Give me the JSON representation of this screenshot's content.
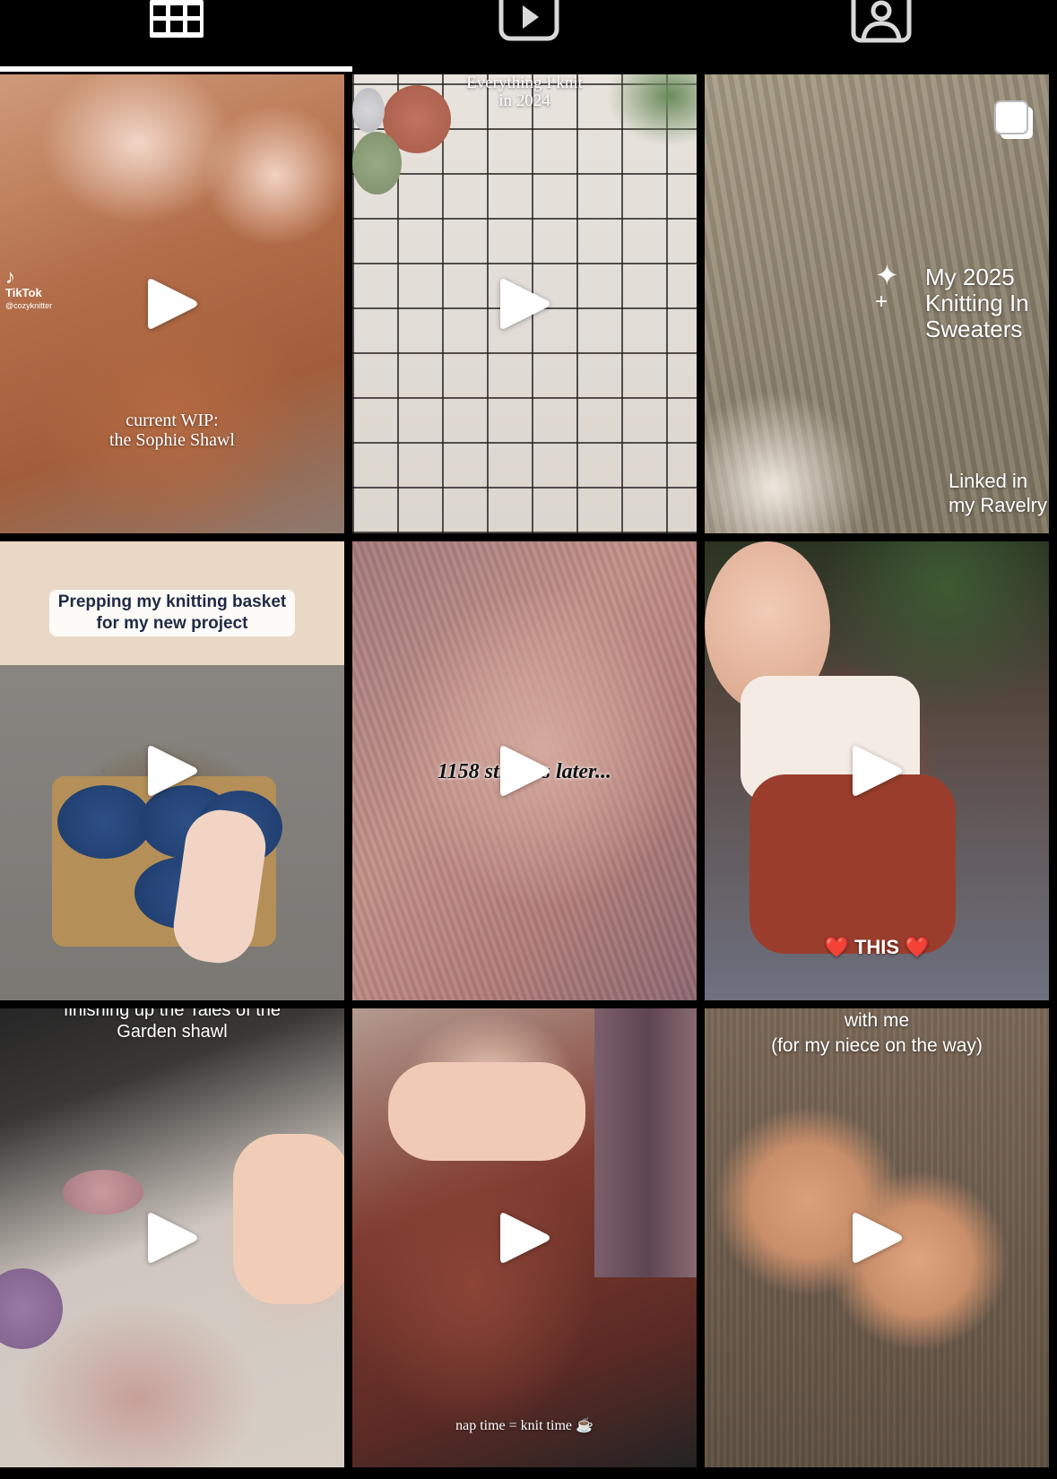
{
  "tabs": [
    {
      "icon": "grid-icon",
      "active": true
    },
    {
      "icon": "video-icon",
      "active": false
    },
    {
      "icon": "tagged-user-icon",
      "active": false
    }
  ],
  "posts": [
    {
      "captions": [
        "current WIP:",
        "the Sophie Shawl"
      ],
      "watermark": {
        "brand": "TikTok",
        "handle": "@cozyknitter"
      }
    },
    {
      "captions": [
        "Everything I knit",
        "in 2024"
      ]
    },
    {
      "captions": [
        "My 2025",
        "Knitting In",
        "Sweaters"
      ],
      "footer": [
        "Linked in",
        "my Ravelry"
      ],
      "multi_icon": "multiple-posts-icon"
    },
    {
      "captions": [
        "Prepping my knitting basket",
        "for my new project"
      ]
    },
    {
      "captions": [
        "1158 stitches later..."
      ]
    },
    {
      "captions": [
        "❤️ THIS ❤️"
      ]
    },
    {
      "captions": [
        "finishing up the Tales of the",
        "Garden shawl"
      ]
    },
    {
      "captions": [
        "nap time = knit time ☕"
      ]
    },
    {
      "captions": [
        "with me",
        "(for my niece on the way)"
      ]
    }
  ]
}
